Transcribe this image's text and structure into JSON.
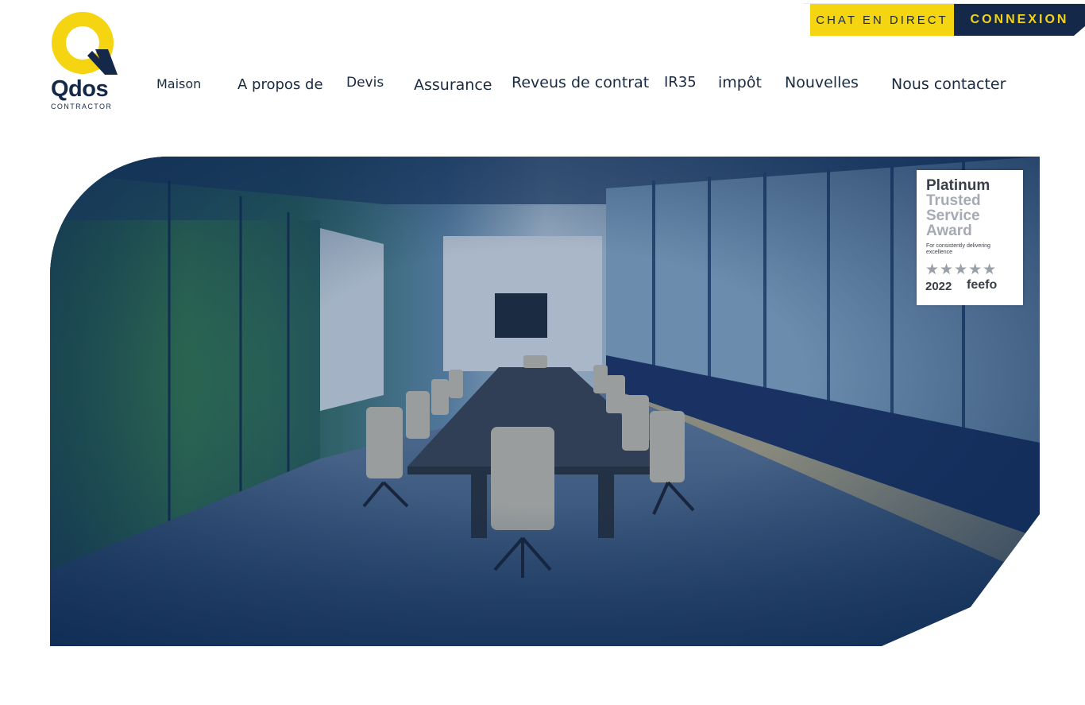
{
  "brand": {
    "name": "Qdos",
    "subtitle": "CONTRACTOR",
    "colors": {
      "yellow": "#f5d411",
      "navy": "#14284a"
    }
  },
  "top_actions": {
    "chat_label": "CHAT EN DIRECT",
    "login_label": "CONNEXION"
  },
  "nav": {
    "items": [
      "Maison",
      "A propos de",
      "Devis",
      "Assurance",
      "Reveus de contrat",
      "IR35",
      "impôt",
      "Nouvelles",
      "Nous contacter"
    ]
  },
  "hero": {
    "image": "conference-room-photo",
    "award": {
      "line1": "Platinum",
      "line2": "Trusted",
      "line3": "Service",
      "line4": "Award",
      "subline": "For consistently delivering excellence",
      "rating_stars": 5,
      "year": "2022",
      "brand": "feefo"
    }
  }
}
